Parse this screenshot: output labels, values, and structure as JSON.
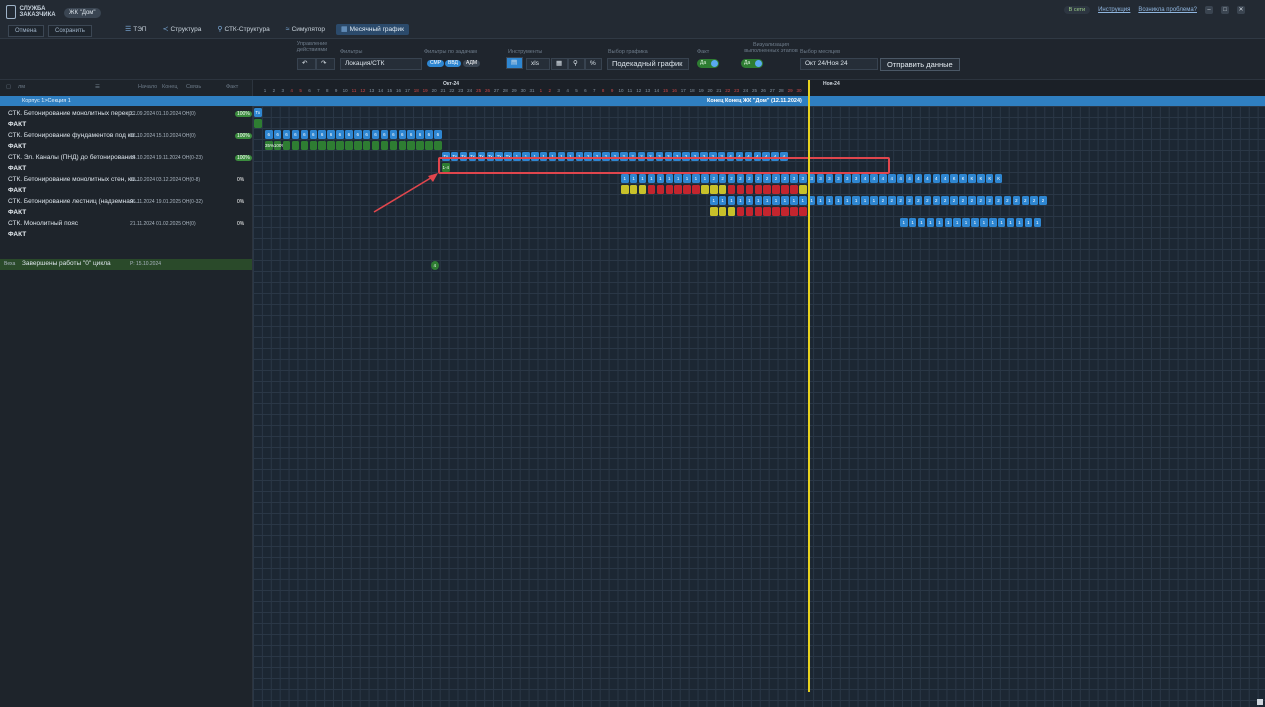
{
  "app": {
    "logo_text": "СЛУЖБА ЗАКАЗЧИКА",
    "project": "ЖК \"Дом\""
  },
  "actions": {
    "cancel": "Отмена",
    "save": "Сохранить"
  },
  "nav": [
    {
      "label": "ТЭП",
      "icon": "list-icon",
      "active": false
    },
    {
      "label": "Структура",
      "icon": "share-icon",
      "active": false
    },
    {
      "label": "СТК-Структура",
      "icon": "link-icon",
      "active": false
    },
    {
      "label": "Симулятор",
      "icon": "simulator-icon",
      "active": false
    },
    {
      "label": "Месячный график",
      "icon": "calendar-icon",
      "active": true
    }
  ],
  "topright": {
    "online": "В сети",
    "instructions": "Инструкция",
    "problem": "Возникла проблема?"
  },
  "toolbar": {
    "manage_label": "Управление действиями",
    "filters_label": "Фильтры",
    "filter_value": "Локация/СТК",
    "task_filters_label": "Фильтры по задачам",
    "task_pills": [
      "СМР",
      "ВВД",
      "АДМ"
    ],
    "tools_label": "Инструменты",
    "export_label": "xls",
    "graph_label": "Выбор графика",
    "graph_value": "Подекадный график",
    "fact_label": "Факт",
    "fact_toggle": "Да",
    "visual_label": "Визуализация выполненных этапов",
    "visual_toggle": "Да",
    "month_label": "Выбор месяцев",
    "month_value": "Окт 24/Ноя 24",
    "send_button": "Отправить данные"
  },
  "table": {
    "search_placeholder": "лм",
    "headers": [
      "Начало",
      "Конец",
      "Связь",
      "Факт"
    ],
    "section": "Корпус 1>Секция 1",
    "section_center": "Конец Конец ЖК \"Дом\" (12.11.2024)",
    "rows": [
      {
        "name": "СТК. Бетонирование монолитных перекр...",
        "start": "22.09.2024",
        "end": "01.10.2024",
        "link": "ОН(0)",
        "pct": "100%"
      },
      {
        "name": "ФАКТ",
        "fact": true
      },
      {
        "name": "СТК. Бетонирование фундаментов под ко...",
        "start": "02.10.2024",
        "end": "15.10.2024",
        "link": "ОН(0)",
        "pct": "100%"
      },
      {
        "name": "ФАКТ",
        "fact": true
      },
      {
        "name": "СТК. Эл. Каналы (ПНД) до бетонирования",
        "start": "16.10.2024",
        "end": "19.11.2024",
        "link": "ОН(0-23)",
        "pct": "100%"
      },
      {
        "name": "ФАКТ",
        "fact": true
      },
      {
        "name": "СТК. Бетонирование монолитных стен, ко...",
        "start": "03.10.2024",
        "end": "03.12.2024",
        "link": "ОН(0-8)",
        "pct": "0%"
      },
      {
        "name": "ФАКТ",
        "fact": true
      },
      {
        "name": "СТК. Бетонирование лестниц (надземная...",
        "start": "06.11.2024",
        "end": "19.01.2025",
        "link": "ОН(0-32)",
        "pct": "0%"
      },
      {
        "name": "ФАКТ",
        "fact": true
      },
      {
        "name": "СТК. Монолитный пояс",
        "start": "21.11.2024",
        "end": "01.02.2025",
        "link": "ОН(0)",
        "pct": "0%"
      },
      {
        "name": "ФАКТ",
        "fact": true
      }
    ],
    "milestone": {
      "tag": "Веха",
      "name": "Завершены работы \"0\" цикла",
      "date": "Р: 15.10.2024"
    }
  },
  "timeline": {
    "months": [
      "Окт-24",
      "Ноя-24"
    ],
    "oct_days": [
      "1",
      "2",
      "3",
      "4",
      "5",
      "6",
      "7",
      "8",
      "9",
      "10",
      "11",
      "12",
      "13",
      "14",
      "15",
      "16",
      "17",
      "18",
      "19",
      "20",
      "21",
      "22",
      "23",
      "24",
      "25",
      "26",
      "27",
      "28",
      "29",
      "30",
      "31"
    ],
    "nov_days": [
      "1",
      "2",
      "3",
      "4",
      "5",
      "6",
      "7",
      "8",
      "9",
      "10",
      "11",
      "12",
      "13",
      "14",
      "15",
      "16",
      "17",
      "18",
      "19",
      "20",
      "21",
      "22",
      "23",
      "24",
      "25",
      "26",
      "27",
      "28",
      "29",
      "30"
    ],
    "bars": {
      "row1": {
        "label": "Тх"
      },
      "row3": {
        "labels": [
          "6",
          "6",
          "6",
          "6",
          "6",
          "6",
          "6",
          "6",
          "6",
          "6",
          "6",
          "6",
          "6",
          "6",
          "6",
          "6",
          "6",
          "6",
          "6",
          "6"
        ],
        "fact": [
          "35%",
          "100%"
        ]
      },
      "row5": {
        "labels": [
          "Тх",
          "Тх",
          "Тх",
          "Тх",
          "Тх",
          "Тх",
          "Тх",
          "Тх",
          "1",
          "1",
          "1",
          "1",
          "1",
          "1",
          "1",
          "1",
          "2",
          "2",
          "2",
          "2",
          "2",
          "2",
          "2",
          "2",
          "3",
          "3",
          "3",
          "3",
          "3",
          "3",
          "3",
          "3",
          "4",
          "4",
          "4",
          "4",
          "4",
          "4",
          "4"
        ],
        "fact": "1-4"
      },
      "row7": {
        "labels": [
          "1",
          "1",
          "1",
          "1",
          "1",
          "1",
          "1",
          "1",
          "1",
          "1",
          "2",
          "2",
          "2",
          "2",
          "2",
          "2",
          "2",
          "2",
          "2",
          "3",
          "3",
          "3",
          "3",
          "3",
          "3",
          "3",
          "3",
          "4",
          "4",
          "4",
          "4",
          "4",
          "4",
          "4",
          "4",
          "4",
          "4",
          "К",
          "К",
          "К",
          "К",
          "К",
          "К"
        ]
      },
      "row9": {
        "labels": [
          "1",
          "1",
          "1",
          "1",
          "1",
          "1",
          "1",
          "1",
          "1",
          "1",
          "1",
          "1",
          "1",
          "1",
          "1",
          "1",
          "1",
          "1",
          "1",
          "2",
          "2",
          "2",
          "2",
          "2",
          "2",
          "2",
          "2",
          "2",
          "2",
          "2",
          "2",
          "2",
          "2",
          "2",
          "2",
          "2",
          "2",
          "2"
        ]
      },
      "row11": {
        "labels": [
          "1",
          "1",
          "1",
          "1",
          "1",
          "1",
          "1",
          "1",
          "1",
          "1",
          "1",
          "1",
          "1",
          "1",
          "1",
          "1"
        ]
      },
      "milestone": {
        "label": "4"
      }
    }
  },
  "colors": {
    "plan": "#2e86d1",
    "fact_done": "#2e7d32",
    "warn": "#c8c12a",
    "late": "#c3252e",
    "today_line": "#e6d11e",
    "highlight": "#e0464d"
  }
}
